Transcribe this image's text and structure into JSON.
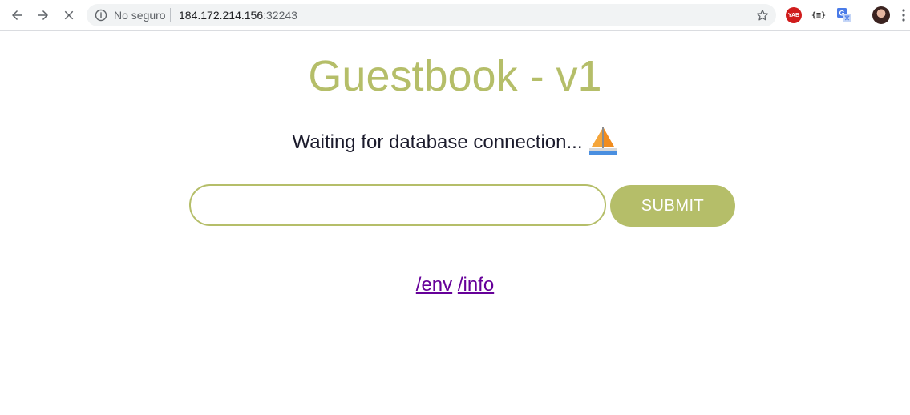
{
  "browser": {
    "security_label": "No seguro",
    "url_host": "184.172.214.156",
    "url_port": ":32243",
    "extensions": {
      "yab_label": "YAB",
      "json_label": "{≡}"
    },
    "icons": [
      "back-icon",
      "forward-icon",
      "stop-icon",
      "info-icon",
      "star-icon",
      "translate-icon",
      "menu-icon"
    ]
  },
  "page": {
    "title": "Guestbook - v1",
    "status_text": "Waiting for database connection...",
    "status_icon": "sailboat-icon",
    "input": {
      "value": "",
      "placeholder": ""
    },
    "submit_label": "SUBMIT",
    "links": [
      {
        "label": "/env"
      },
      {
        "label": "/info"
      }
    ]
  },
  "colors": {
    "accent": "#b5be69",
    "link": "#660099",
    "text": "#1b1b2c"
  }
}
